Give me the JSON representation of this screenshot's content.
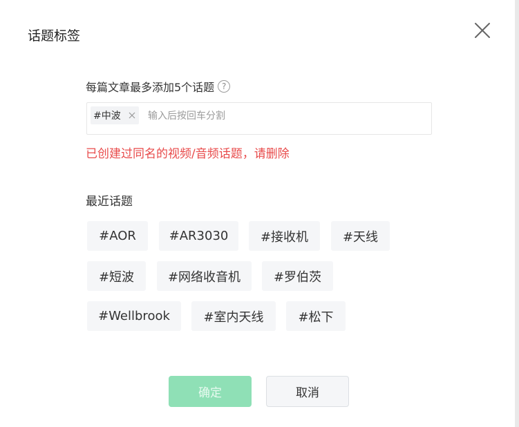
{
  "dialog": {
    "title": "话题标签",
    "close_icon": "close-icon"
  },
  "input_section": {
    "limit_label": "每篇文章最多添加5个话题",
    "help_icon": "?",
    "selected_tags": [
      {
        "label": "#中波"
      }
    ],
    "placeholder": "输入后按回车分割",
    "value": ""
  },
  "error": {
    "message": "已创建过同名的视频/音频话题，请删除",
    "color": "#e84a4a"
  },
  "recent": {
    "title": "最近话题",
    "topics": [
      {
        "label": "#AOR"
      },
      {
        "label": "#AR3030"
      },
      {
        "label": "#接收机"
      },
      {
        "label": "#天线"
      },
      {
        "label": "#短波"
      },
      {
        "label": "#网络收音机"
      },
      {
        "label": "#罗伯茨"
      },
      {
        "label": "#Wellbrook"
      },
      {
        "label": "#室内天线"
      },
      {
        "label": "#松下"
      }
    ]
  },
  "actions": {
    "confirm_label": "确定",
    "cancel_label": "取消",
    "confirm_color": "#8fe0b6"
  }
}
